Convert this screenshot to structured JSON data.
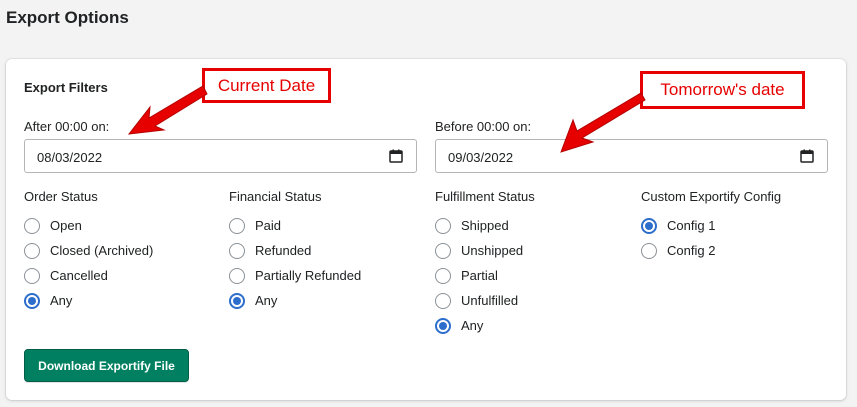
{
  "page": {
    "title": "Export Options"
  },
  "filters": {
    "title": "Export Filters",
    "after": {
      "label": "After 00:00 on:",
      "value": "08/03/2022"
    },
    "before": {
      "label": "Before 00:00 on:",
      "value": "09/03/2022"
    }
  },
  "groups": {
    "order_status": {
      "title": "Order Status",
      "options": [
        "Open",
        "Closed (Archived)",
        "Cancelled",
        "Any"
      ],
      "selected": "Any"
    },
    "financial_status": {
      "title": "Financial Status",
      "options": [
        "Paid",
        "Refunded",
        "Partially Refunded",
        "Any"
      ],
      "selected": "Any"
    },
    "fulfillment_status": {
      "title": "Fulfillment Status",
      "options": [
        "Shipped",
        "Unshipped",
        "Partial",
        "Unfulfilled",
        "Any"
      ],
      "selected": "Any"
    },
    "custom_config": {
      "title": "Custom Exportify Config",
      "options": [
        "Config 1",
        "Config 2"
      ],
      "selected": "Config 1"
    }
  },
  "actions": {
    "download_label": "Download Exportify File"
  },
  "annotations": {
    "current_date": "Current Date",
    "tomorrow_date": "Tomorrow's date",
    "color": "#e60000"
  },
  "colors": {
    "primary_button": "#008060",
    "radio_accent": "#2c6ecb"
  }
}
